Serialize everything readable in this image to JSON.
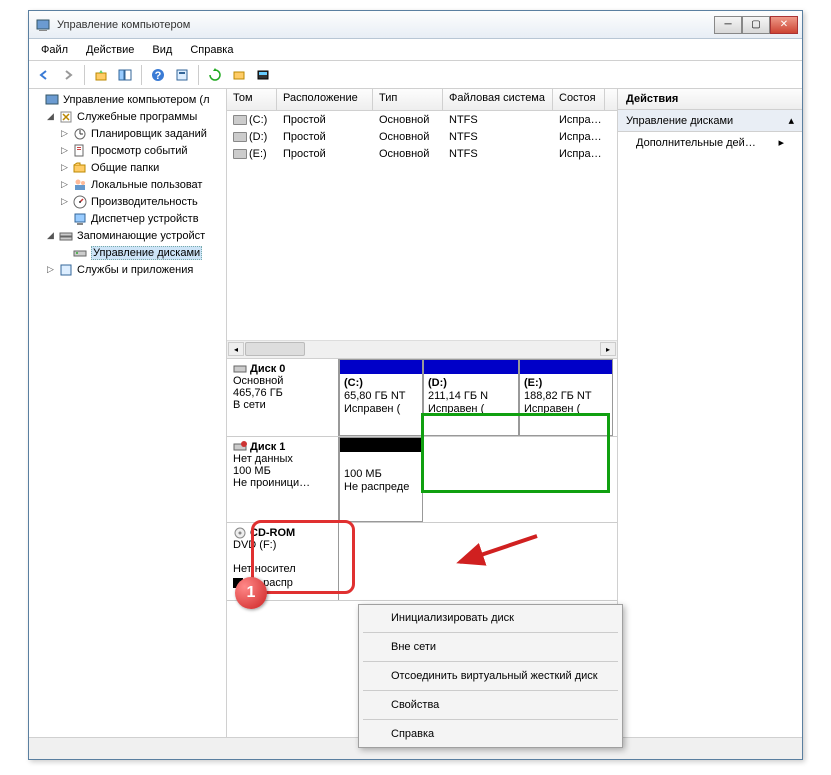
{
  "window": {
    "title": "Управление компьютером"
  },
  "menu": {
    "file": "Файл",
    "action": "Действие",
    "view": "Вид",
    "help": "Справка"
  },
  "tree": {
    "root": "Управление компьютером (л",
    "system_tools": "Служебные программы",
    "task_sched": "Планировщик заданий",
    "event_viewer": "Просмотр событий",
    "shared": "Общие папки",
    "local_users": "Локальные пользоват",
    "perf": "Производительность",
    "devmgr": "Диспетчер устройств",
    "storage": "Запоминающие устройст",
    "diskmgmt": "Управление дисками",
    "services": "Службы и приложения"
  },
  "columns": {
    "vol": "Том",
    "layout": "Расположение",
    "type": "Тип",
    "fs": "Файловая система",
    "status": "Состоя"
  },
  "vol_layout": "Простой",
  "vol_type": "Основной",
  "vol_fs": "NTFS",
  "vol_status": "Испра…",
  "volumes": [
    {
      "name": "(C:)"
    },
    {
      "name": "(D:)"
    },
    {
      "name": "(E:)"
    }
  ],
  "disk0": {
    "name": "Диск 0",
    "type": "Основной",
    "size": "465,76 ГБ",
    "state": "В сети",
    "parts": {
      "c": {
        "label": "(C:)",
        "size": "65,80 ГБ NT",
        "status": "Исправен ("
      },
      "d": {
        "label": "(D:)",
        "size": "211,14 ГБ N",
        "status": "Исправен ("
      },
      "e": {
        "label": "(E:)",
        "size": "188,82 ГБ NT",
        "status": "Исправен ("
      }
    }
  },
  "disk1": {
    "name": "Диск 1",
    "type": "Нет данных",
    "size": "100 МБ",
    "state": "Не проиници…",
    "part": {
      "size": "100 МБ",
      "status": "Не распреде"
    }
  },
  "cdrom": {
    "name": "CD-ROM",
    "drive": "DVD (F:)",
    "state": "Нет носител",
    "legend": "Не распр"
  },
  "actions": {
    "header": "Действия",
    "diskmgmt": "Управление дисками",
    "more": "Дополнительные дей…"
  },
  "context": {
    "init": "Инициализировать диск",
    "offline": "Вне сети",
    "detach": "Отсоединить виртуальный жесткий диск",
    "props": "Свойства",
    "help": "Справка"
  }
}
